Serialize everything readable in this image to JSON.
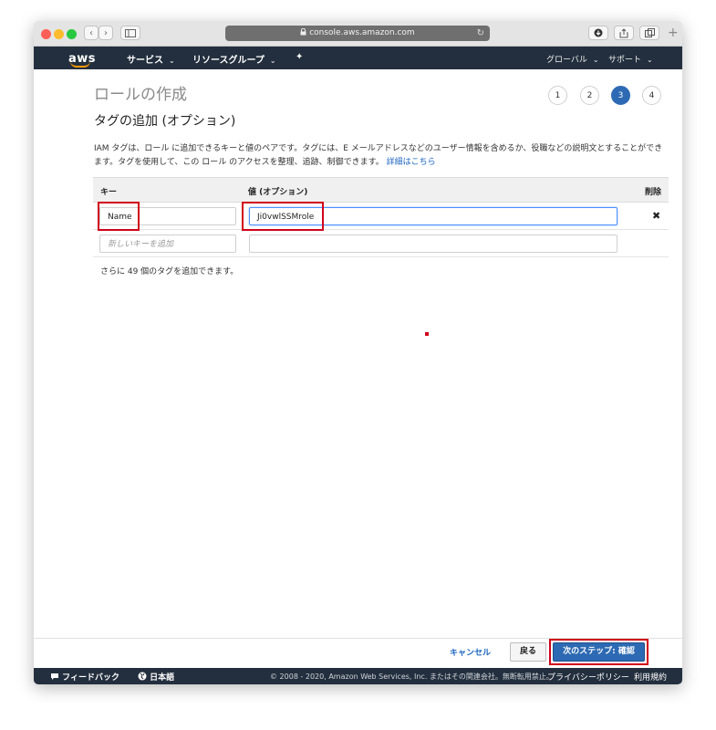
{
  "browser": {
    "url": "console.aws.amazon.com",
    "back_glyph": "‹",
    "forward_glyph": "›",
    "reload_glyph": "↻",
    "plus_glyph": "+"
  },
  "nav": {
    "logo": "aws",
    "services": "サービス",
    "resource_groups": "リソースグループ",
    "pin_glyph": "✦",
    "region": "グローバル",
    "support": "サポート",
    "caret": "⌄"
  },
  "page": {
    "title": "ロールの作成",
    "section_title": "タグの追加 (オプション)",
    "steps": [
      "1",
      "2",
      "3",
      "4"
    ],
    "active_step": 3,
    "description": "IAM タグは、ロール に追加できるキーと値のペアです。タグには、E メールアドレスなどのユーザー情報を含めるか、役職などの説明文とすることができます。タグを使用して、この ロール のアクセスを整理、追跡、制御できます。",
    "learn_more": "詳細はこちら"
  },
  "table": {
    "col_key": "キー",
    "col_value": "値 (オプション)",
    "col_delete": "削除",
    "rows": [
      {
        "key": "Name",
        "value": "Ji0vwlSSMrole"
      }
    ],
    "new_key_placeholder": "新しいキーを追加",
    "delete_glyph": "✖",
    "remaining": "さらに 49 個のタグを追加できます。"
  },
  "actions": {
    "cancel": "キャンセル",
    "back": "戻る",
    "next": "次のステップ: 確認"
  },
  "footer": {
    "feedback": "フィードバック",
    "language": "日本語",
    "copyright": "© 2008 - 2020, Amazon Web Services, Inc. またはその関連会社。無断転用禁止。",
    "privacy": "プライバシーポリシー",
    "terms": "利用規約"
  },
  "colors": {
    "nav_bg": "#232f3e",
    "accent": "#2d6ab3",
    "highlight": "#d0021b"
  }
}
